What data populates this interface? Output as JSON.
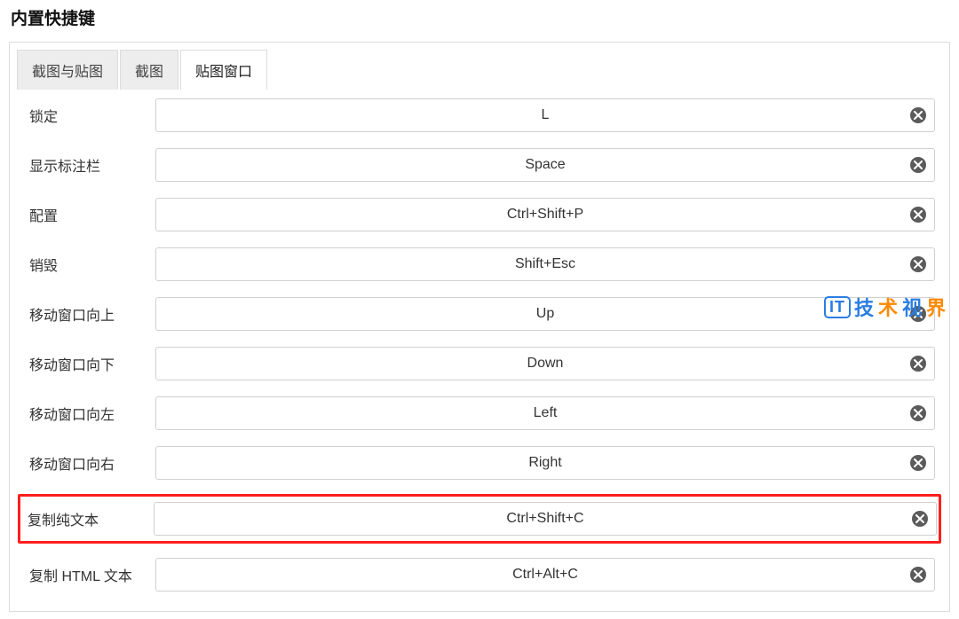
{
  "title": "内置快捷键",
  "tabs": [
    {
      "label": "截图与贴图",
      "active": false
    },
    {
      "label": "截图",
      "active": false
    },
    {
      "label": "贴图窗口",
      "active": true
    }
  ],
  "rows": [
    {
      "label": "锁定",
      "value": "L",
      "highlight": false
    },
    {
      "label": "显示标注栏",
      "value": "Space",
      "highlight": false
    },
    {
      "label": "配置",
      "value": "Ctrl+Shift+P",
      "highlight": false
    },
    {
      "label": "销毁",
      "value": "Shift+Esc",
      "highlight": false
    },
    {
      "label": "移动窗口向上",
      "value": "Up",
      "highlight": false
    },
    {
      "label": "移动窗口向下",
      "value": "Down",
      "highlight": false
    },
    {
      "label": "移动窗口向左",
      "value": "Left",
      "highlight": false
    },
    {
      "label": "移动窗口向右",
      "value": "Right",
      "highlight": false
    },
    {
      "label": "复制纯文本",
      "value": "Ctrl+Shift+C",
      "highlight": true
    },
    {
      "label": "复制 HTML 文本",
      "value": "Ctrl+Alt+C",
      "highlight": false
    }
  ],
  "watermark": {
    "badge": "IT",
    "w1": "技",
    "w2": "术",
    "w3": "视",
    "w4": "界"
  }
}
